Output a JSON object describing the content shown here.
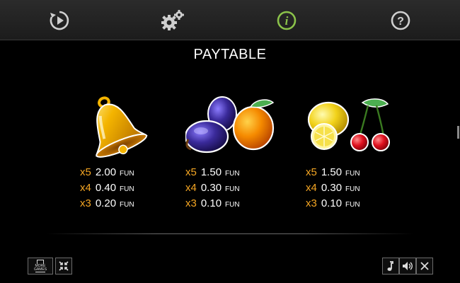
{
  "topbar": {
    "buttons": [
      {
        "name": "autoplay-icon",
        "color": "#cfcfcf"
      },
      {
        "name": "settings-gear-icon",
        "color": "#cfcfcf"
      },
      {
        "name": "info-icon",
        "color": "#8bc34a",
        "glyph": "i"
      },
      {
        "name": "help-icon",
        "color": "#cfcfcf",
        "glyph": "?"
      }
    ]
  },
  "title": "PAYTABLE",
  "paytable": [
    {
      "symbol": "bell-icon",
      "rows": [
        {
          "mult": "x5",
          "amount": "2.00",
          "currency": "FUN"
        },
        {
          "mult": "x4",
          "amount": "0.40",
          "currency": "FUN"
        },
        {
          "mult": "x3",
          "amount": "0.20",
          "currency": "FUN"
        }
      ]
    },
    {
      "symbol": "plum-orange-icon",
      "rows": [
        {
          "mult": "x5",
          "amount": "1.50",
          "currency": "FUN"
        },
        {
          "mult": "x4",
          "amount": "0.30",
          "currency": "FUN"
        },
        {
          "mult": "x3",
          "amount": "0.10",
          "currency": "FUN"
        }
      ]
    },
    {
      "symbol": "lemon-cherry-icon",
      "rows": [
        {
          "mult": "x5",
          "amount": "1.50",
          "currency": "FUN"
        },
        {
          "mult": "x4",
          "amount": "0.30",
          "currency": "FUN"
        },
        {
          "mult": "x3",
          "amount": "0.10",
          "currency": "FUN"
        }
      ]
    }
  ],
  "bottom": {
    "more_games": {
      "line1": "MORE",
      "line2": "GAMES"
    },
    "buttons": [
      "fullscreen-exit-icon",
      "music-note-icon",
      "sound-icon",
      "close-icon"
    ]
  },
  "colors": {
    "multiplier": "#f5a623",
    "text": "#ffffff",
    "active_tab": "#8bc34a"
  }
}
